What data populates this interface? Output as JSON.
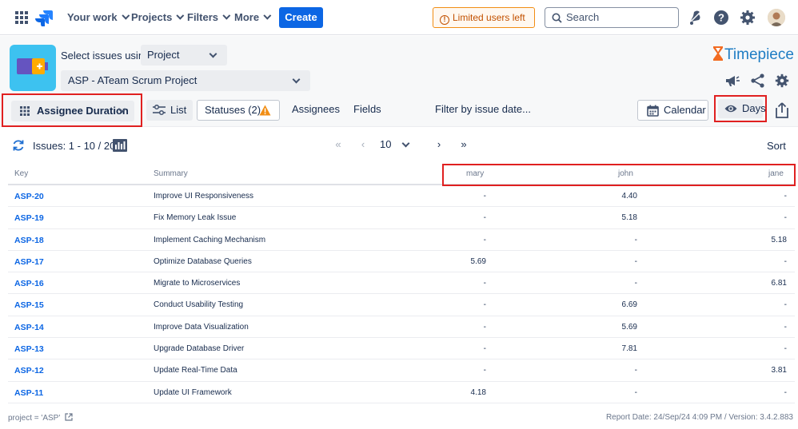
{
  "topnav": {
    "items": [
      {
        "label": "Your work"
      },
      {
        "label": "Projects"
      },
      {
        "label": "Filters"
      },
      {
        "label": "More"
      }
    ],
    "create_label": "Create",
    "limited_users_label": "Limited users left",
    "search_placeholder": "Search",
    "accent_color": "#0c66e4"
  },
  "header": {
    "select_label": "Select issues using",
    "source_value": "Project",
    "project_value": "ASP - ATeam Scrum Project",
    "brand": "Timepiece"
  },
  "toolbar": {
    "view_label": "Assignee Duration",
    "list_label": "List",
    "statuses_label": "Statuses (2)",
    "assignees_label": "Assignees",
    "fields_label": "Fields",
    "filter_label": "Filter by issue date...",
    "calendar_label": "Calendar",
    "days_label": "Days"
  },
  "pager": {
    "issues_label": "Issues: 1 - 10 / 20",
    "page_size": "10",
    "first": "«",
    "prev": "‹",
    "next": "›",
    "last": "»",
    "sort_label": "Sort"
  },
  "table": {
    "columns": [
      "Key",
      "Summary",
      "mary",
      "john",
      "jane"
    ],
    "rows": [
      {
        "key": "ASP-20",
        "summary": "Improve UI Responsiveness",
        "mary": "-",
        "john": "4.40",
        "jane": "-"
      },
      {
        "key": "ASP-19",
        "summary": "Fix Memory Leak Issue",
        "mary": "-",
        "john": "5.18",
        "jane": "-"
      },
      {
        "key": "ASP-18",
        "summary": "Implement Caching Mechanism",
        "mary": "-",
        "john": "-",
        "jane": "5.18"
      },
      {
        "key": "ASP-17",
        "summary": "Optimize Database Queries",
        "mary": "5.69",
        "john": "-",
        "jane": "-"
      },
      {
        "key": "ASP-16",
        "summary": "Migrate to Microservices",
        "mary": "-",
        "john": "-",
        "jane": "6.81"
      },
      {
        "key": "ASP-15",
        "summary": "Conduct Usability Testing",
        "mary": "-",
        "john": "6.69",
        "jane": "-"
      },
      {
        "key": "ASP-14",
        "summary": "Improve Data Visualization",
        "mary": "-",
        "john": "5.69",
        "jane": "-"
      },
      {
        "key": "ASP-13",
        "summary": "Upgrade Database Driver",
        "mary": "-",
        "john": "7.81",
        "jane": "-"
      },
      {
        "key": "ASP-12",
        "summary": "Update Real-Time Data",
        "mary": "-",
        "john": "-",
        "jane": "3.81"
      },
      {
        "key": "ASP-11",
        "summary": "Update UI Framework",
        "mary": "4.18",
        "john": "-",
        "jane": "-"
      }
    ]
  },
  "footer": {
    "query": "project = 'ASP'",
    "report_info": "Report Date: 24/Sep/24 4:09 PM / Version: 3.4.2.883"
  },
  "colors": {
    "highlight_border": "#e02020",
    "link": "#0c66e4",
    "warning": "#f18d13"
  }
}
